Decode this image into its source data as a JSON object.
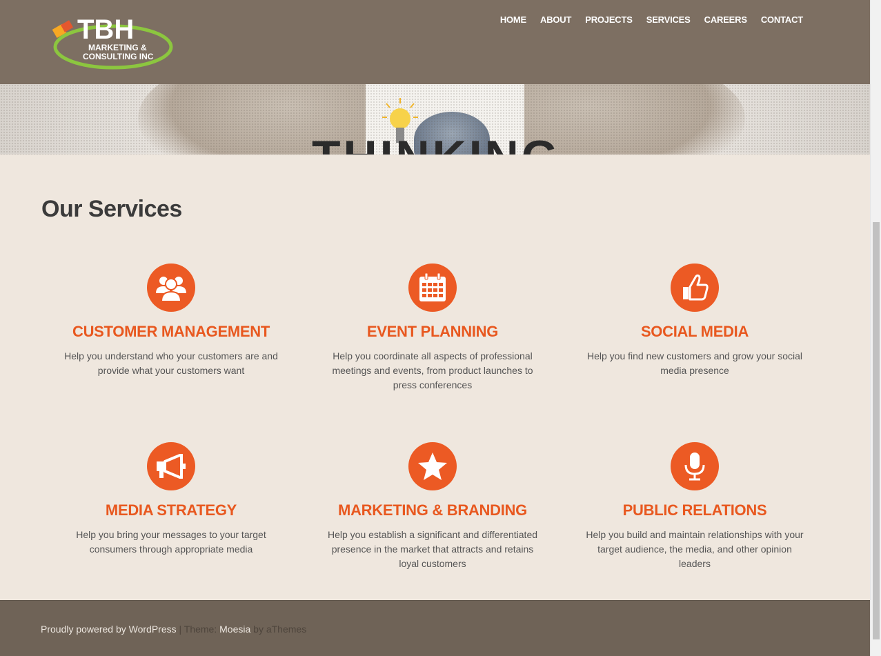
{
  "logo": {
    "line1": "TBH",
    "line2": "MARKETING &",
    "line3": "CONSULTING INC"
  },
  "nav": [
    "HOME",
    "ABOUT",
    "PROJECTS",
    "SERVICES",
    "CAREERS",
    "CONTACT"
  ],
  "hero": {
    "word": "THINKING"
  },
  "services": {
    "title": "Our Services",
    "items": [
      {
        "icon": "users-icon",
        "title": "CUSTOMER MANAGEMENT",
        "desc": "Help you understand who your customers are and provide what your customers want"
      },
      {
        "icon": "calendar-icon",
        "title": "EVENT PLANNING",
        "desc": "Help you coordinate all aspects of professional meetings and events, from product launches to press conferences"
      },
      {
        "icon": "thumbs-up-icon",
        "title": "SOCIAL MEDIA",
        "desc": "Help you find new customers and grow your social media presence"
      },
      {
        "icon": "megaphone-icon",
        "title": "MEDIA STRATEGY",
        "desc": "Help you bring your messages to your target consumers through appropriate media"
      },
      {
        "icon": "star-icon",
        "title": "MARKETING & BRANDING",
        "desc": "Help you establish a significant and differentiated presence in the market that attracts and retains loyal customers"
      },
      {
        "icon": "microphone-icon",
        "title": "PUBLIC RELATIONS",
        "desc": "Help you build and maintain relationships with your target audience, the media, and other opinion leaders"
      }
    ]
  },
  "footer": {
    "powered": "Proudly powered by WordPress",
    "sep": " | Theme: ",
    "theme": "Moesia",
    "by": " by aThemes"
  },
  "colors": {
    "header": "#7d6f62",
    "accent": "#ec5a24",
    "background": "#efe7de",
    "footer": "#6f6357"
  }
}
